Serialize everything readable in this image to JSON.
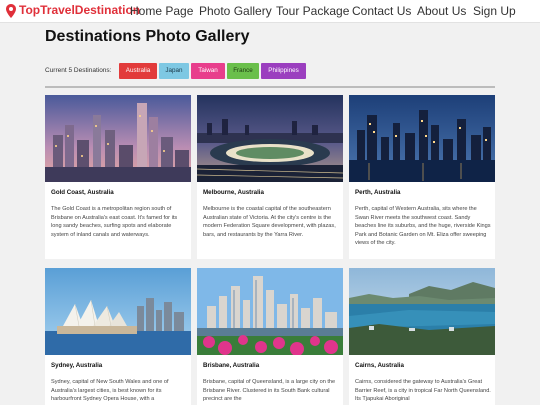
{
  "brand": {
    "name": "TopTravelDestination",
    "icon": "map-pin-icon",
    "color": "#e0303a"
  },
  "nav": {
    "items": [
      {
        "label": "Home Page"
      },
      {
        "label": "Photo Gallery"
      },
      {
        "label": "Tour Package"
      },
      {
        "label": "Contact Us"
      },
      {
        "label": "About Us"
      },
      {
        "label": "Sign Up"
      }
    ]
  },
  "page": {
    "title": "Destinations Photo Gallery"
  },
  "destinations": {
    "label": "Current 5 Destinations:",
    "tags": [
      {
        "label": "Australia",
        "bg": "#e23b3b",
        "fg": "#ffffff"
      },
      {
        "label": "Japan",
        "bg": "#7ec8e3",
        "fg": "#1c3a4a"
      },
      {
        "label": "Taiwan",
        "bg": "#e83e8c",
        "fg": "#ffffff"
      },
      {
        "label": "France",
        "bg": "#6abf4b",
        "fg": "#1f3a13"
      },
      {
        "label": "Philippines",
        "bg": "#9b3fbf",
        "fg": "#ffffff"
      }
    ]
  },
  "cards": [
    {
      "title": "Gold Coast, Australia",
      "image": "gold-coast-skyline-photo",
      "desc": "The Gold Coast is a metropolitan region south of Brisbane on Australia's east coast. It's famed for its long sandy beaches, surfing spots and elaborate system of inland canals and waterways."
    },
    {
      "title": "Melbourne, Australia",
      "image": "melbourne-night-photo",
      "desc": "Melbourne is the coastal capital of the southeastern Australian state of Victoria. At the city's centre is the modern Federation Square development, with plazas, bars, and restaurants by the Yarra River."
    },
    {
      "title": "Perth, Australia",
      "image": "perth-skyline-photo",
      "desc": "Perth, capital of Western Australia, sits where the Swan River meets the southwest coast. Sandy beaches line its suburbs, and the huge, riverside Kings Park and Botanic Garden on Mt. Eliza offer sweeping views of the city."
    },
    {
      "title": "Sydney, Australia",
      "image": "sydney-opera-house-photo",
      "desc": "Sydney, capital of New South Wales and one of Australia's largest cities, is best known for its harbourfront Sydney Opera House, with a"
    },
    {
      "title": "Brisbane, Australia",
      "image": "brisbane-skyline-photo",
      "desc": "Brisbane, capital of Queensland, is a large city on the Brisbane River. Clustered in its South Bank cultural precinct are the"
    },
    {
      "title": "Cairns, Australia",
      "image": "cairns-coast-photo",
      "desc": "Cairns, considered the gateway to Australia's Great Barrier Reef, is a city in tropical Far North Queensland. Its Tjapukai Aboriginal"
    }
  ]
}
